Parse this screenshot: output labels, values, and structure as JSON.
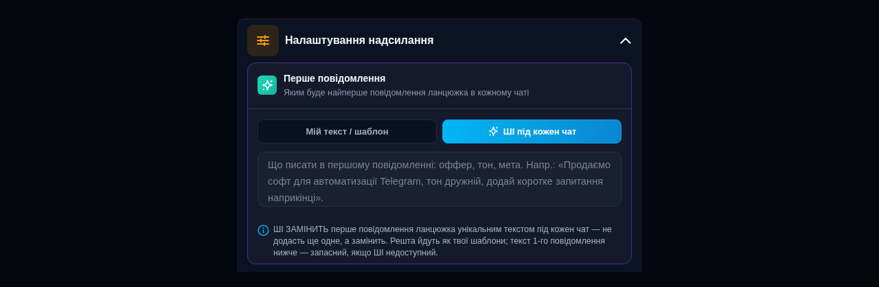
{
  "section": {
    "title": "Налаштування надсилання",
    "expanded": true
  },
  "card": {
    "title": "Перше повідомлення",
    "subtitle": "Яким буде найперше повідомлення ланцюжка в кожному чаті"
  },
  "mode_options": [
    {
      "label": "Мій текст / шаблон",
      "selected": false,
      "icon": false
    },
    {
      "label": "ШІ під кожен чат",
      "selected": true,
      "icon": true
    }
  ],
  "prompt_field": {
    "placeholder": "Що писати в першому повідомленні: оффер, тон, мета. Напр.: «Продаємо софт для автоматизації Telegram, тон дружній, додай коротке запитання наприкінці»."
  },
  "note": "ШІ ЗАМІНИТЬ перше повідомлення ланцюжка унікальним текстом під кожен чат — не додасть ще одне, а замінить. Решта йдуть як твої шаблони; текст 1-го повідомлення нижче — запасний, якщо ШІ недоступний."
}
